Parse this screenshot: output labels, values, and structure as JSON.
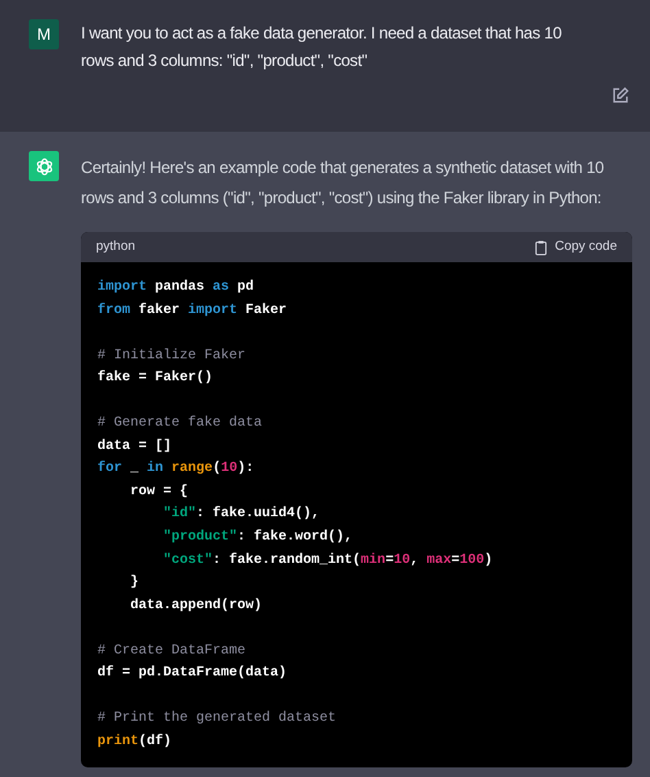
{
  "messages": [
    {
      "kind": "user",
      "avatar": "M",
      "text": "I want you to act as a fake data generator. I need a dataset that has 10 rows and 3 columns: \"id\", \"product\", \"cost\""
    },
    {
      "kind": "assistant",
      "text": "Certainly! Here's an example code that generates a synthetic dataset with 10 rows and 3 columns (\"id\", \"product\", \"cost\") using the Faker library in Python:",
      "code_block": {
        "language": "python",
        "copy_label": "Copy code",
        "lines": [
          {
            "space_before": false,
            "tokens": [
              {
                "kind": "keyword",
                "text": "import"
              },
              {
                "kind": "plain",
                "text": " pandas "
              },
              {
                "kind": "keyword",
                "text": "as"
              },
              {
                "kind": "plain",
                "text": " pd"
              }
            ]
          },
          {
            "space_before": false,
            "tokens": [
              {
                "kind": "keyword",
                "text": "from"
              },
              {
                "kind": "plain",
                "text": " faker "
              },
              {
                "kind": "keyword",
                "text": "import"
              },
              {
                "kind": "plain",
                "text": " Faker"
              }
            ]
          },
          {
            "space_before": true,
            "tokens": [
              {
                "kind": "comment",
                "text": "# Initialize Faker"
              }
            ]
          },
          {
            "space_before": false,
            "tokens": [
              {
                "kind": "plain",
                "text": "fake = Faker()"
              }
            ]
          },
          {
            "space_before": true,
            "tokens": [
              {
                "kind": "comment",
                "text": "# Generate fake data"
              }
            ]
          },
          {
            "space_before": false,
            "tokens": [
              {
                "kind": "plain",
                "text": "data = []"
              }
            ]
          },
          {
            "space_before": false,
            "tokens": [
              {
                "kind": "keyword",
                "text": "for"
              },
              {
                "kind": "plain",
                "text": " _ "
              },
              {
                "kind": "keyword",
                "text": "in "
              },
              {
                "kind": "builtin",
                "text": "range"
              },
              {
                "kind": "plain",
                "text": "("
              },
              {
                "kind": "number",
                "text": "10"
              },
              {
                "kind": "plain",
                "text": "):"
              }
            ],
            "children": [
              {
                "space_before": false,
                "tokens": [
                  {
                    "kind": "plain",
                    "text": "row = {"
                  }
                ],
                "children": [
                  {
                    "space_before": false,
                    "tokens": [
                      {
                        "kind": "string",
                        "text": "\"id\""
                      },
                      {
                        "kind": "plain",
                        "text": ": fake.uuid4(),"
                      }
                    ]
                  },
                  {
                    "space_before": false,
                    "tokens": [
                      {
                        "kind": "string",
                        "text": "\"product\""
                      },
                      {
                        "kind": "plain",
                        "text": ": fake.word(),"
                      }
                    ]
                  },
                  {
                    "space_before": false,
                    "tokens": [
                      {
                        "kind": "string",
                        "text": "\"cost\""
                      },
                      {
                        "kind": "plain",
                        "text": ": fake.random_int("
                      },
                      {
                        "kind": "param",
                        "text": "min"
                      },
                      {
                        "kind": "plain",
                        "text": "="
                      },
                      {
                        "kind": "number",
                        "text": "10"
                      },
                      {
                        "kind": "plain",
                        "text": ", "
                      },
                      {
                        "kind": "param",
                        "text": "max"
                      },
                      {
                        "kind": "plain",
                        "text": "="
                      },
                      {
                        "kind": "number",
                        "text": "100"
                      },
                      {
                        "kind": "plain",
                        "text": ")"
                      }
                    ]
                  }
                ]
              },
              {
                "space_before": false,
                "tokens": [
                  {
                    "kind": "plain",
                    "text": "}"
                  }
                ]
              },
              {
                "space_before": false,
                "tokens": [
                  {
                    "kind": "plain",
                    "text": "data.append(row)"
                  }
                ]
              }
            ]
          },
          {
            "space_before": true,
            "tokens": [
              {
                "kind": "comment",
                "text": "# Create DataFrame"
              }
            ]
          },
          {
            "space_before": false,
            "tokens": [
              {
                "kind": "plain",
                "text": "df = pd.DataFrame(data)"
              }
            ]
          },
          {
            "space_before": true,
            "tokens": [
              {
                "kind": "comment",
                "text": "# Print the generated dataset"
              }
            ]
          },
          {
            "space_before": false,
            "tokens": [
              {
                "kind": "builtin",
                "text": "print"
              },
              {
                "kind": "plain",
                "text": "(df)"
              }
            ]
          }
        ]
      }
    }
  ]
}
